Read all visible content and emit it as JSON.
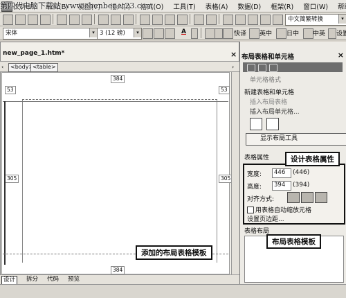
{
  "watermark": "第四代电脑下载站 www.chenbenet23.com",
  "menu": [
    "文件(F)",
    "编辑(E)",
    "视图(V)",
    "插入(I)",
    "格式(O)",
    "工具(T)",
    "表格(A)",
    "数据(D)",
    "框架(R)",
    "窗口(W)",
    "帮助(H)"
  ],
  "toolbar": {
    "font_name": "宋体",
    "font_size": "3 (12 磅)",
    "font_color_label": "A",
    "convert_label": "中文简繁转换",
    "buttons": [
      "快译",
      "英中",
      "日中",
      "中英",
      "设置"
    ]
  },
  "document": {
    "tab_title": "new_page_1.htm*",
    "tags": [
      "<body>",
      "<table>"
    ],
    "ruler_top": "384",
    "ruler_bottom": "384",
    "height_left_top": "53",
    "height_right_top": "53",
    "height_left_mid": "305",
    "height_right_mid": "305",
    "views": [
      "设计",
      "拆分",
      "代码",
      "预览"
    ]
  },
  "panel": {
    "title": "布局表格和单元格",
    "top_cut_text": "单元格格式",
    "new_section": "新建表格和单元格",
    "insert_table": "插入布局表格",
    "insert_cell": "插入布局单元格...",
    "show_tools": "显示布局工具",
    "props_title": "表格属性",
    "width_label": "宽度:",
    "width_value": "446",
    "width_paren": "(446)",
    "height_label": "高度:",
    "height_value": "394",
    "height_paren": "(394)",
    "align_label": "对齐方式:",
    "autoscale_label": "用表格自动缩放元格",
    "margin_label": "设置页边距...",
    "template_label": "表格布局"
  },
  "callouts": {
    "props": "设计表格属性",
    "added": "添加的布局表格模板",
    "template": "布局表格模板"
  }
}
